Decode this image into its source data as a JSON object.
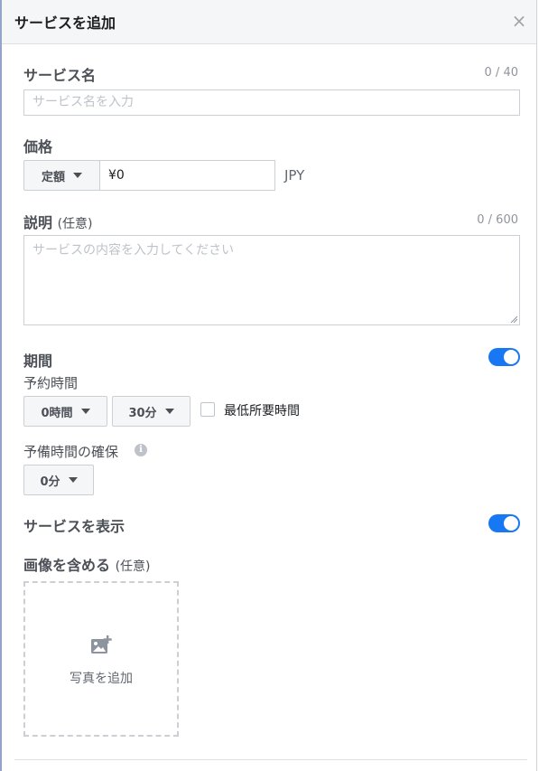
{
  "header": {
    "title": "サービスを追加",
    "close_glyph": "×"
  },
  "service_name": {
    "label": "サービス名",
    "counter": "0 / 40",
    "placeholder": "サービス名を入力",
    "value": ""
  },
  "price": {
    "label": "価格",
    "type_selected": "定額",
    "value": "¥0",
    "currency": "JPY"
  },
  "description": {
    "label": "説明",
    "optional": "(任意)",
    "counter": "0 / 600",
    "placeholder": "サービスの内容を入力してください",
    "value": ""
  },
  "duration": {
    "label": "期間",
    "toggle_on": true,
    "booking_time_label": "予約時間",
    "hours_selected": "0時間",
    "minutes_selected": "30分",
    "min_required_label": "最低所要時間",
    "min_required_checked": false,
    "buffer_label": "予備時間の確保",
    "buffer_selected": "0分",
    "info_glyph": "i"
  },
  "show_service": {
    "label": "サービスを表示",
    "toggle_on": true
  },
  "images": {
    "label": "画像を含める",
    "optional": "(任意)",
    "add_photo_label": "写真を追加",
    "icon": "add-photo-icon"
  },
  "colors": {
    "accent": "#1877f2",
    "header_bg": "#f5f6f7",
    "border": "#ccd0d5"
  }
}
